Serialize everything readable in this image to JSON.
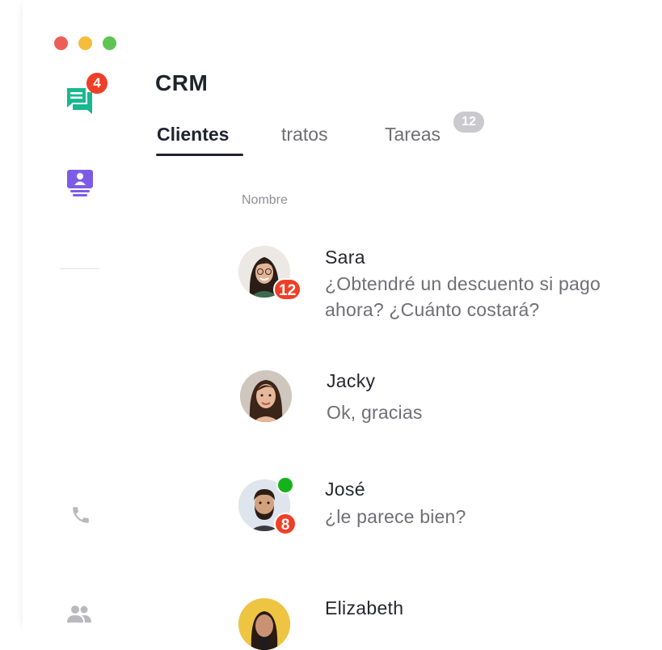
{
  "window": {
    "controls": [
      "close",
      "minimize",
      "zoom"
    ]
  },
  "sidebar": {
    "items": [
      {
        "icon": "chat-icon",
        "badge": "4",
        "color": "#17b890"
      },
      {
        "icon": "contact-book-icon",
        "color": "#7c5ce6"
      },
      {
        "icon": "phone-icon",
        "color": "#b9b9bd"
      },
      {
        "icon": "people-icon",
        "color": "#b9b9bd"
      }
    ]
  },
  "header": {
    "title": "CRM"
  },
  "tabs": [
    {
      "label": "Clientes",
      "active": true
    },
    {
      "label": "tratos",
      "active": false
    },
    {
      "label": "Tareas",
      "active": false,
      "count": "12"
    }
  ],
  "list": {
    "column_header": "Nombre",
    "contacts": [
      {
        "name": "Sara",
        "message": "¿Obtendré un descuento si pago ahora? ¿Cuánto costará?",
        "message_line1": "¿Obtendré un descuento si pago",
        "message_line2": "ahora? ¿Cuánto costará?",
        "unread": "12",
        "online": false
      },
      {
        "name": "Jacky",
        "message": "Ok, gracias",
        "online": false
      },
      {
        "name": "José",
        "message": "¿le parece bien?",
        "unread": "8",
        "online": true
      },
      {
        "name": "Elizabeth",
        "message": "",
        "online": false
      }
    ]
  },
  "colors": {
    "badge": "#ef3f27",
    "online": "#14b31a",
    "active_tab": "#1f2230",
    "count_pill": "#c9c9ce"
  }
}
